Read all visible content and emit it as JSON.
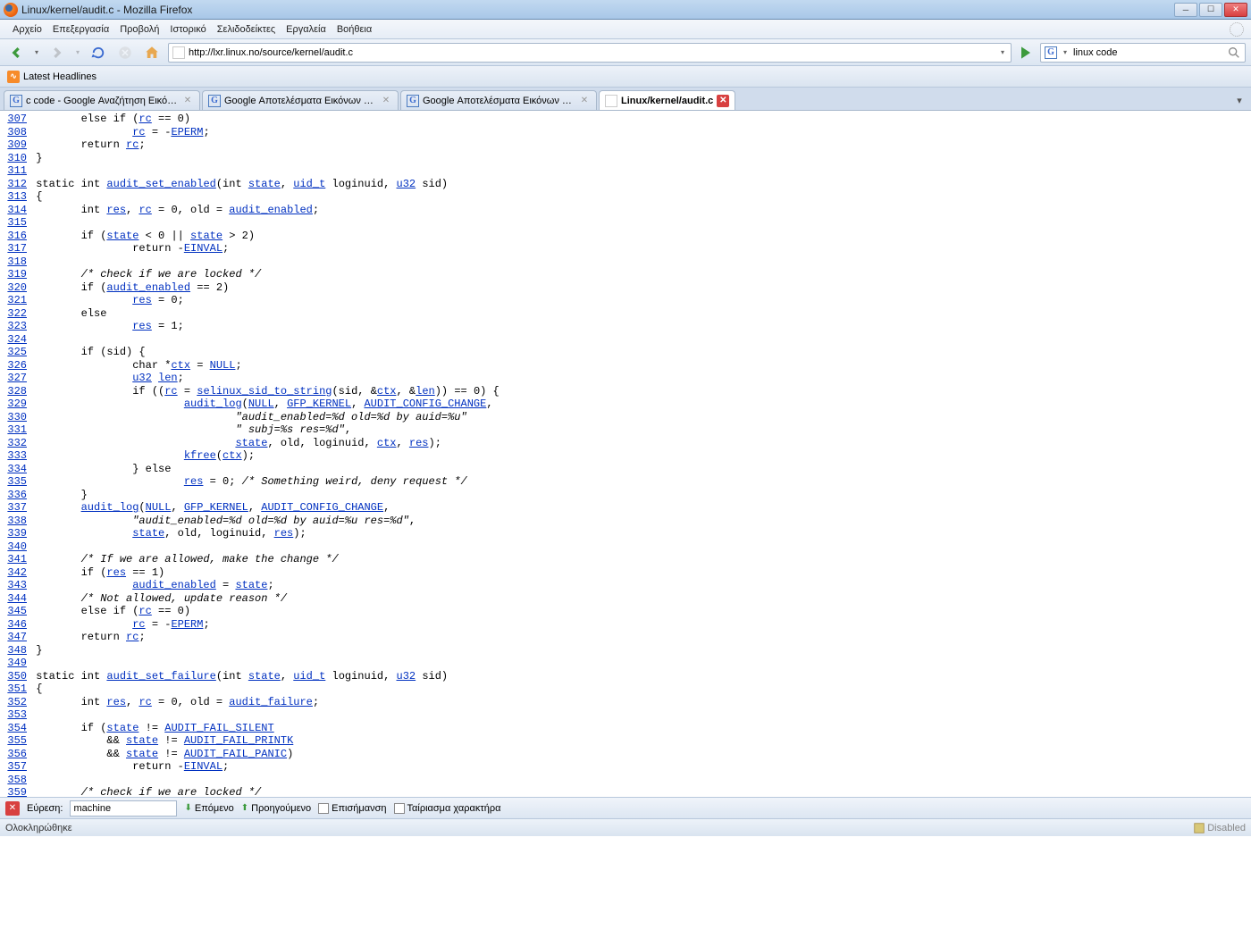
{
  "window": {
    "title": "Linux/kernel/audit.c - Mozilla Firefox"
  },
  "menubar": [
    "Αρχείο",
    "Επεξεργασία",
    "Προβολή",
    "Ιστορικό",
    "Σελιδοδείκτες",
    "Εργαλεία",
    "Βοήθεια"
  ],
  "url": "http://lxr.linux.no/source/kernel/audit.c",
  "search": {
    "value": "linux code"
  },
  "bookmark_toolbar": {
    "item": "Latest Headlines"
  },
  "tabs": [
    {
      "label": "c code - Google Αναζήτηση Εικόνων",
      "icon": "google",
      "active": false
    },
    {
      "label": "Google Αποτελέσματα Εικόνων για...",
      "icon": "google",
      "active": false
    },
    {
      "label": "Google Αποτελέσματα Εικόνων για...",
      "icon": "google",
      "active": false
    },
    {
      "label": "Linux/kernel/audit.c",
      "icon": "page",
      "active": true
    }
  ],
  "code_lines": [
    {
      "n": 307,
      "segs": [
        {
          "t": "        else if ("
        },
        {
          "t": "rc",
          "l": 1
        },
        {
          "t": " == 0)"
        }
      ]
    },
    {
      "n": 308,
      "segs": [
        {
          "t": "                "
        },
        {
          "t": "rc",
          "l": 1
        },
        {
          "t": " = -"
        },
        {
          "t": "EPERM",
          "l": 1
        },
        {
          "t": ";"
        }
      ]
    },
    {
      "n": 309,
      "segs": [
        {
          "t": "        return "
        },
        {
          "t": "rc",
          "l": 1
        },
        {
          "t": ";"
        }
      ]
    },
    {
      "n": 310,
      "segs": [
        {
          "t": " }"
        }
      ]
    },
    {
      "n": 311,
      "segs": []
    },
    {
      "n": 312,
      "segs": [
        {
          "t": " static int "
        },
        {
          "t": "audit_set_enabled",
          "l": 1
        },
        {
          "t": "(int "
        },
        {
          "t": "state",
          "l": 1
        },
        {
          "t": ", "
        },
        {
          "t": "uid_t",
          "l": 1
        },
        {
          "t": " loginuid, "
        },
        {
          "t": "u32",
          "l": 1
        },
        {
          "t": " sid)"
        }
      ]
    },
    {
      "n": 313,
      "segs": [
        {
          "t": " {"
        }
      ]
    },
    {
      "n": 314,
      "segs": [
        {
          "t": "        int "
        },
        {
          "t": "res",
          "l": 1
        },
        {
          "t": ", "
        },
        {
          "t": "rc",
          "l": 1
        },
        {
          "t": " = 0, old = "
        },
        {
          "t": "audit_enabled",
          "l": 1
        },
        {
          "t": ";"
        }
      ]
    },
    {
      "n": 315,
      "segs": []
    },
    {
      "n": 316,
      "segs": [
        {
          "t": "        if ("
        },
        {
          "t": "state",
          "l": 1
        },
        {
          "t": " < 0 || "
        },
        {
          "t": "state",
          "l": 1
        },
        {
          "t": " > 2)"
        }
      ]
    },
    {
      "n": 317,
      "segs": [
        {
          "t": "                return -"
        },
        {
          "t": "EINVAL",
          "l": 1
        },
        {
          "t": ";"
        }
      ]
    },
    {
      "n": 318,
      "segs": []
    },
    {
      "n": 319,
      "segs": [
        {
          "t": "        "
        },
        {
          "t": "/* check if we are locked */",
          "c": 1
        }
      ]
    },
    {
      "n": 320,
      "segs": [
        {
          "t": "        if ("
        },
        {
          "t": "audit_enabled",
          "l": 1
        },
        {
          "t": " == 2)"
        }
      ]
    },
    {
      "n": 321,
      "segs": [
        {
          "t": "                "
        },
        {
          "t": "res",
          "l": 1
        },
        {
          "t": " = 0;"
        }
      ]
    },
    {
      "n": 322,
      "segs": [
        {
          "t": "        else"
        }
      ]
    },
    {
      "n": 323,
      "segs": [
        {
          "t": "                "
        },
        {
          "t": "res",
          "l": 1
        },
        {
          "t": " = 1;"
        }
      ]
    },
    {
      "n": 324,
      "segs": []
    },
    {
      "n": 325,
      "segs": [
        {
          "t": "        if (sid) {"
        }
      ]
    },
    {
      "n": 326,
      "segs": [
        {
          "t": "                char *"
        },
        {
          "t": "ctx",
          "l": 1
        },
        {
          "t": " = "
        },
        {
          "t": "NULL",
          "l": 1
        },
        {
          "t": ";"
        }
      ]
    },
    {
      "n": 327,
      "segs": [
        {
          "t": "                "
        },
        {
          "t": "u32",
          "l": 1
        },
        {
          "t": " "
        },
        {
          "t": "len",
          "l": 1
        },
        {
          "t": ";"
        }
      ]
    },
    {
      "n": 328,
      "segs": [
        {
          "t": "                if (("
        },
        {
          "t": "rc",
          "l": 1
        },
        {
          "t": " = "
        },
        {
          "t": "selinux_sid_to_string",
          "l": 1
        },
        {
          "t": "(sid, &"
        },
        {
          "t": "ctx",
          "l": 1
        },
        {
          "t": ", &"
        },
        {
          "t": "len",
          "l": 1
        },
        {
          "t": ")) == 0) {"
        }
      ]
    },
    {
      "n": 329,
      "segs": [
        {
          "t": "                        "
        },
        {
          "t": "audit_log",
          "l": 1
        },
        {
          "t": "("
        },
        {
          "t": "NULL",
          "l": 1
        },
        {
          "t": ", "
        },
        {
          "t": "GFP_KERNEL",
          "l": 1
        },
        {
          "t": ", "
        },
        {
          "t": "AUDIT_CONFIG_CHANGE",
          "l": 1
        },
        {
          "t": ","
        }
      ]
    },
    {
      "n": 330,
      "segs": [
        {
          "t": "                                "
        },
        {
          "t": "\"audit_enabled=%d old=%d by auid=%u\"",
          "c": 1
        }
      ]
    },
    {
      "n": 331,
      "segs": [
        {
          "t": "                                "
        },
        {
          "t": "\" subj=%s res=%d\"",
          "c": 1
        },
        {
          "t": ","
        }
      ]
    },
    {
      "n": 332,
      "segs": [
        {
          "t": "                                "
        },
        {
          "t": "state",
          "l": 1
        },
        {
          "t": ", old, loginuid, "
        },
        {
          "t": "ctx",
          "l": 1
        },
        {
          "t": ", "
        },
        {
          "t": "res",
          "l": 1
        },
        {
          "t": ");"
        }
      ]
    },
    {
      "n": 333,
      "segs": [
        {
          "t": "                        "
        },
        {
          "t": "kfree",
          "l": 1
        },
        {
          "t": "("
        },
        {
          "t": "ctx",
          "l": 1
        },
        {
          "t": ");"
        }
      ]
    },
    {
      "n": 334,
      "segs": [
        {
          "t": "                } else"
        }
      ]
    },
    {
      "n": 335,
      "segs": [
        {
          "t": "                        "
        },
        {
          "t": "res",
          "l": 1
        },
        {
          "t": " = 0; "
        },
        {
          "t": "/* Something weird, deny request */",
          "c": 1
        }
      ]
    },
    {
      "n": 336,
      "segs": [
        {
          "t": "        }"
        }
      ]
    },
    {
      "n": 337,
      "segs": [
        {
          "t": "        "
        },
        {
          "t": "audit_log",
          "l": 1
        },
        {
          "t": "("
        },
        {
          "t": "NULL",
          "l": 1
        },
        {
          "t": ", "
        },
        {
          "t": "GFP_KERNEL",
          "l": 1
        },
        {
          "t": ", "
        },
        {
          "t": "AUDIT_CONFIG_CHANGE",
          "l": 1
        },
        {
          "t": ","
        }
      ]
    },
    {
      "n": 338,
      "segs": [
        {
          "t": "                "
        },
        {
          "t": "\"audit_enabled=%d old=%d by auid=%u res=%d\"",
          "c": 1
        },
        {
          "t": ","
        }
      ]
    },
    {
      "n": 339,
      "segs": [
        {
          "t": "                "
        },
        {
          "t": "state",
          "l": 1
        },
        {
          "t": ", old, loginuid, "
        },
        {
          "t": "res",
          "l": 1
        },
        {
          "t": ");"
        }
      ]
    },
    {
      "n": 340,
      "segs": []
    },
    {
      "n": 341,
      "segs": [
        {
          "t": "        "
        },
        {
          "t": "/* If we are allowed, make the change */",
          "c": 1
        }
      ]
    },
    {
      "n": 342,
      "segs": [
        {
          "t": "        if ("
        },
        {
          "t": "res",
          "l": 1
        },
        {
          "t": " == 1)"
        }
      ]
    },
    {
      "n": 343,
      "segs": [
        {
          "t": "                "
        },
        {
          "t": "audit_enabled",
          "l": 1
        },
        {
          "t": " = "
        },
        {
          "t": "state",
          "l": 1
        },
        {
          "t": ";"
        }
      ]
    },
    {
      "n": 344,
      "segs": [
        {
          "t": "        "
        },
        {
          "t": "/* Not allowed, update reason */",
          "c": 1
        }
      ]
    },
    {
      "n": 345,
      "segs": [
        {
          "t": "        else if ("
        },
        {
          "t": "rc",
          "l": 1
        },
        {
          "t": " == 0)"
        }
      ]
    },
    {
      "n": 346,
      "segs": [
        {
          "t": "                "
        },
        {
          "t": "rc",
          "l": 1
        },
        {
          "t": " = -"
        },
        {
          "t": "EPERM",
          "l": 1
        },
        {
          "t": ";"
        }
      ]
    },
    {
      "n": 347,
      "segs": [
        {
          "t": "        return "
        },
        {
          "t": "rc",
          "l": 1
        },
        {
          "t": ";"
        }
      ]
    },
    {
      "n": 348,
      "segs": [
        {
          "t": " }"
        }
      ]
    },
    {
      "n": 349,
      "segs": []
    },
    {
      "n": 350,
      "segs": [
        {
          "t": " static int "
        },
        {
          "t": "audit_set_failure",
          "l": 1
        },
        {
          "t": "(int "
        },
        {
          "t": "state",
          "l": 1
        },
        {
          "t": ", "
        },
        {
          "t": "uid_t",
          "l": 1
        },
        {
          "t": " loginuid, "
        },
        {
          "t": "u32",
          "l": 1
        },
        {
          "t": " sid)"
        }
      ]
    },
    {
      "n": 351,
      "segs": [
        {
          "t": " {"
        }
      ]
    },
    {
      "n": 352,
      "segs": [
        {
          "t": "        int "
        },
        {
          "t": "res",
          "l": 1
        },
        {
          "t": ", "
        },
        {
          "t": "rc",
          "l": 1
        },
        {
          "t": " = 0, old = "
        },
        {
          "t": "audit_failure",
          "l": 1
        },
        {
          "t": ";"
        }
      ]
    },
    {
      "n": 353,
      "segs": []
    },
    {
      "n": 354,
      "segs": [
        {
          "t": "        if ("
        },
        {
          "t": "state",
          "l": 1
        },
        {
          "t": " != "
        },
        {
          "t": "AUDIT_FAIL_SILENT",
          "l": 1
        }
      ]
    },
    {
      "n": 355,
      "segs": [
        {
          "t": "            && "
        },
        {
          "t": "state",
          "l": 1
        },
        {
          "t": " != "
        },
        {
          "t": "AUDIT_FAIL_PRINTK",
          "l": 1
        }
      ]
    },
    {
      "n": 356,
      "segs": [
        {
          "t": "            && "
        },
        {
          "t": "state",
          "l": 1
        },
        {
          "t": " != "
        },
        {
          "t": "AUDIT_FAIL_PANIC",
          "l": 1
        },
        {
          "t": ")"
        }
      ]
    },
    {
      "n": 357,
      "segs": [
        {
          "t": "                return -"
        },
        {
          "t": "EINVAL",
          "l": 1
        },
        {
          "t": ";"
        }
      ]
    },
    {
      "n": 358,
      "segs": []
    },
    {
      "n": 359,
      "segs": [
        {
          "t": "        "
        },
        {
          "t": "/* check if we are locked */",
          "c": 1
        }
      ]
    }
  ],
  "findbar": {
    "label": "Εύρεση:",
    "value": "machine",
    "next": "Επόμενο",
    "prev": "Προηγούμενο",
    "highlight": "Επισήμανση",
    "matchcase": "Ταίριασμα χαρακτήρα"
  },
  "status": {
    "text": "Ολοκληρώθηκε",
    "right": "Disabled"
  }
}
